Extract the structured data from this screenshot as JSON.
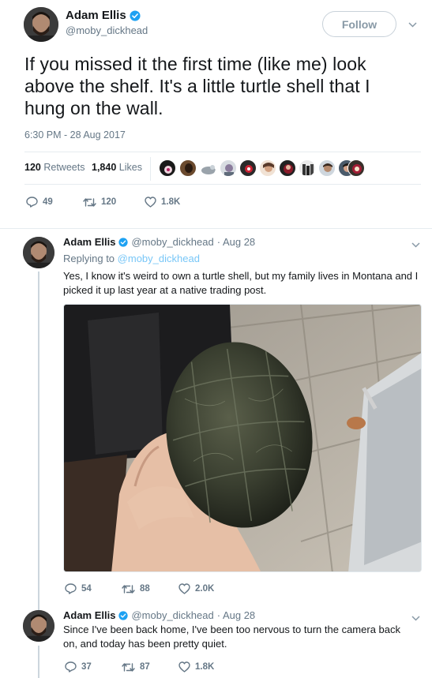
{
  "colors": {
    "accent": "#1da1f2",
    "muted": "#657786",
    "text": "#14171a",
    "border": "#e6ecf0"
  },
  "main": {
    "name": "Adam Ellis",
    "handle": "@moby_dickhead",
    "follow_label": "Follow",
    "text": "If you missed it the first time (like me) look above the shelf. It's a little turtle shell that I hung on the wall.",
    "time": "6:30 PM - 28 Aug 2017",
    "retweets_count": "120",
    "retweets_label": "Retweets",
    "likes_count": "1,840",
    "likes_label": "Likes",
    "reply_count": "49",
    "retweet_count": "120",
    "like_count": "1.8K"
  },
  "replies": [
    {
      "name": "Adam Ellis",
      "handle": "@moby_dickhead",
      "date": "· Aug 28",
      "replying_prefix": "Replying to",
      "replying_to": "@moby_dickhead",
      "text": "Yes, I know it's weird to own a turtle shell, but my family lives in Montana and I picked it up last year at a native trading post.",
      "reply_count": "54",
      "retweet_count": "88",
      "like_count": "2.0K"
    },
    {
      "name": "Adam Ellis",
      "handle": "@moby_dickhead",
      "date": "· Aug 28",
      "text": "Since I've been back home, I've been too nervous to turn the camera back on, and today has been pretty quiet.",
      "reply_count": "37",
      "retweet_count": "87",
      "like_count": "1.8K"
    }
  ]
}
